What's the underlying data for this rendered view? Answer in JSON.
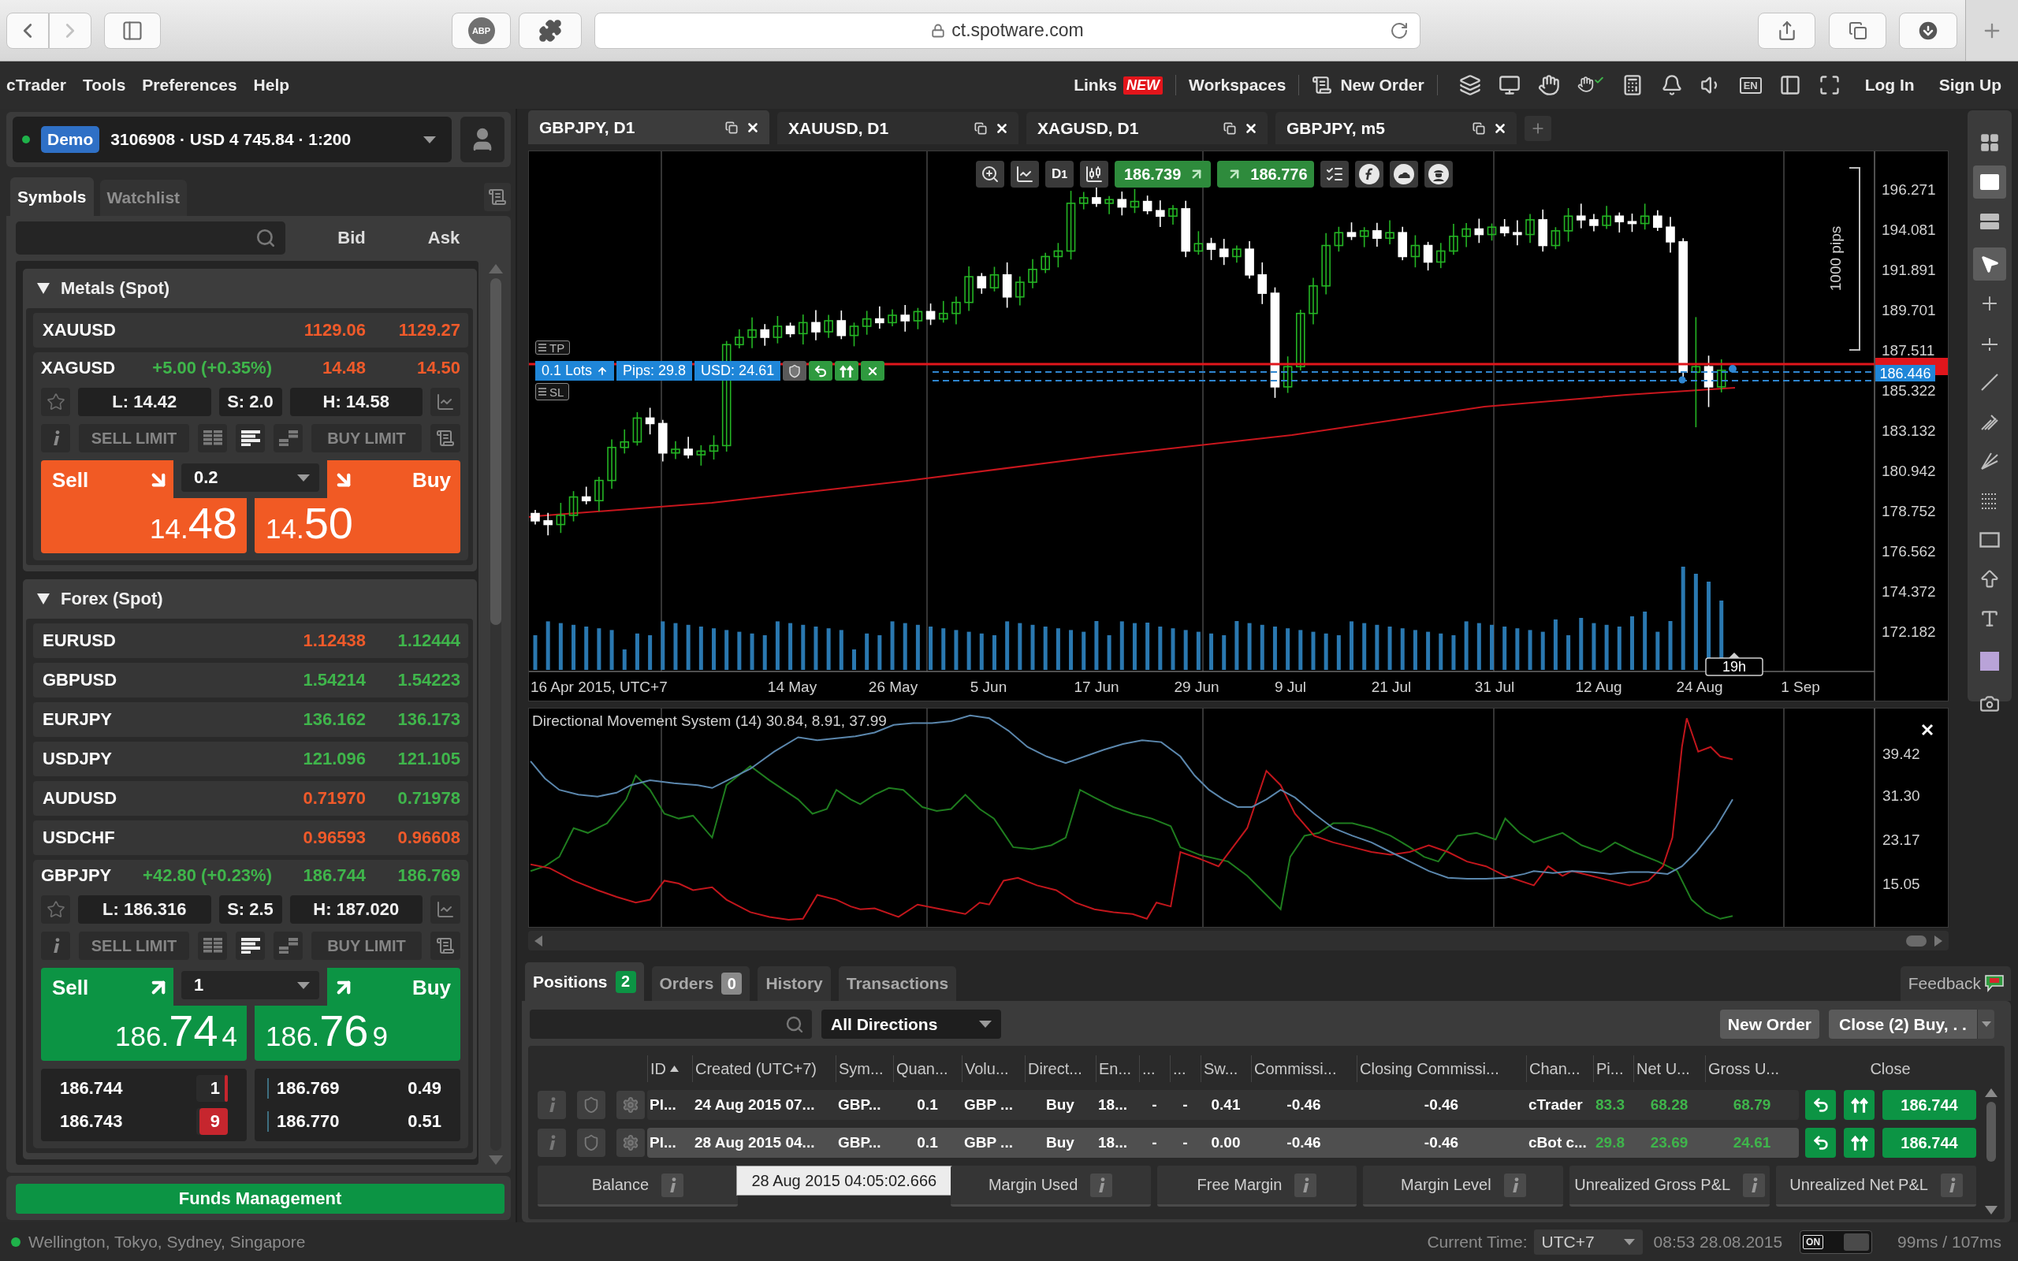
{
  "browser": {
    "extension_badge": "ABP",
    "url": "ct.spotware.com"
  },
  "menu": {
    "items": [
      "cTrader",
      "Tools",
      "Preferences",
      "Help"
    ],
    "links": "Links",
    "links_badge": "NEW",
    "workspaces": "Workspaces",
    "new_order": "New Order",
    "language": "EN",
    "log_in": "Log In",
    "sign_up": "Sign Up"
  },
  "account": {
    "connected": true,
    "mode": "Demo",
    "summary": "3106908 · USD 4 745.84 · 1:200"
  },
  "symbol_tabs": [
    {
      "label": "Symbols",
      "selected": true
    },
    {
      "label": "Watchlist",
      "selected": false
    }
  ],
  "quote_headers": [
    "Bid",
    "Ask"
  ],
  "groups": [
    {
      "name": "Metals (Spot)",
      "expanded": true,
      "symbols": [
        {
          "kind": "row",
          "name": "XAUUSD",
          "bid": "1129.06",
          "ask": "1129.27",
          "bid_up": false,
          "ask_up": false
        },
        {
          "kind": "card",
          "name": "XAGUSD",
          "change": "+5.00 (+0.35%)",
          "change_up": true,
          "bid": "14.48",
          "ask": "14.50",
          "bid_up": false,
          "ask_up": false,
          "favorite": false,
          "low": "L: 14.42",
          "spread": "S: 2.0",
          "high": "H: 14.58",
          "sell_limit": "SELL LIMIT",
          "buy_limit": "BUY LIMIT",
          "views": [
            {
              "kind": "columns",
              "selected": false
            },
            {
              "kind": "ladder",
              "selected": true
            },
            {
              "kind": "depth",
              "selected": false
            }
          ],
          "rising": false,
          "quantity": "0.2",
          "sell": {
            "label": "Sell",
            "head": "14.",
            "big": "48"
          },
          "buy": {
            "label": "Buy",
            "head": "14.",
            "big": "50"
          }
        }
      ]
    },
    {
      "name": "Forex (Spot)",
      "expanded": true,
      "symbols": [
        {
          "kind": "row",
          "name": "EURUSD",
          "bid": "1.12438",
          "ask": "1.12444",
          "bid_up": false,
          "ask_up": true
        },
        {
          "kind": "row",
          "name": "GBPUSD",
          "bid": "1.54214",
          "ask": "1.54223",
          "bid_up": true,
          "ask_up": true
        },
        {
          "kind": "row",
          "name": "EURJPY",
          "bid": "136.162",
          "ask": "136.173",
          "bid_up": true,
          "ask_up": true
        },
        {
          "kind": "row",
          "name": "USDJPY",
          "bid": "121.096",
          "ask": "121.105",
          "bid_up": true,
          "ask_up": true
        },
        {
          "kind": "row",
          "name": "AUDUSD",
          "bid": "0.71970",
          "ask": "0.71978",
          "bid_up": false,
          "ask_up": true
        },
        {
          "kind": "row",
          "name": "USDCHF",
          "bid": "0.96593",
          "ask": "0.96608",
          "bid_up": false,
          "ask_up": false
        },
        {
          "kind": "card",
          "name": "GBPJPY",
          "change": "+42.80 (+0.23%)",
          "change_up": true,
          "bid": "186.744",
          "ask": "186.769",
          "bid_up": true,
          "ask_up": true,
          "favorite": false,
          "low": "L: 186.316",
          "spread": "S: 2.5",
          "high": "H: 187.020",
          "sell_limit": "SELL LIMIT",
          "buy_limit": "BUY LIMIT",
          "views": [
            {
              "kind": "columns",
              "selected": false
            },
            {
              "kind": "ladder",
              "selected": true
            },
            {
              "kind": "depth",
              "selected": false
            }
          ],
          "rising": true,
          "quantity": "1",
          "sell": {
            "label": "Sell",
            "head": "186.",
            "big": "74",
            "tail": "4"
          },
          "buy": {
            "label": "Buy",
            "head": "186.",
            "big": "76",
            "tail": "9"
          },
          "depth": {
            "bids": [
              {
                "price": "186.744",
                "size": "1",
                "level": 0.1
              },
              {
                "price": "186.743",
                "size": "9",
                "level": 0.9
              }
            ],
            "asks": [
              {
                "price": "186.769",
                "size": "0.49"
              },
              {
                "price": "186.770",
                "size": "0.51"
              }
            ]
          }
        }
      ]
    }
  ],
  "funds_button": "Funds Management",
  "chart_tabs": [
    {
      "label": "GBPJPY, D1",
      "selected": true
    },
    {
      "label": "XAUUSD, D1",
      "selected": false
    },
    {
      "label": "XAGUSD, D1",
      "selected": false
    },
    {
      "label": "GBPJPY, m5",
      "selected": false
    }
  ],
  "chart": {
    "period": "D",
    "period_count": "1",
    "sell_price": "186.739",
    "buy_price": "186.776",
    "price_axis": [
      "196.271",
      "194.081",
      "191.891",
      "189.701",
      "187.511",
      "185.322",
      "183.132",
      "180.942",
      "178.752",
      "176.562",
      "174.372",
      "172.182"
    ],
    "price_tag": "186.446",
    "date_axis": [
      "16 Apr 2015, UTC+7",
      "14 May",
      "26 May",
      "5 Jun",
      "17 Jun",
      "29 Jun",
      "9 Jul",
      "21 Jul",
      "31 Jul",
      "12 Aug",
      "24 Aug",
      "1 Sep"
    ],
    "time_marker": "19h",
    "range_label": "1000 pips",
    "take_profit": "TP",
    "stop_loss": "SL",
    "position": {
      "lots": "0.1 Lots",
      "pips": "Pips: 29.8",
      "usd": "USD: 24.61"
    }
  },
  "indicator": {
    "title": "Directional Movement System (14) 30.84, 8.91, 37.99",
    "axis": [
      "39.42",
      "31.30",
      "23.17",
      "15.05"
    ]
  },
  "tool_groups": [
    {
      "tools": [
        {
          "kind": "grid",
          "selected": false
        },
        {
          "kind": "single",
          "selected": true
        },
        {
          "kind": "rows",
          "selected": false
        }
      ]
    },
    {
      "tools": [
        {
          "kind": "cursor",
          "selected": true
        },
        {
          "kind": "crosshair",
          "selected": false
        },
        {
          "kind": "ray",
          "selected": false
        },
        {
          "kind": "line",
          "selected": false
        },
        {
          "kind": "pitchfork",
          "selected": false
        },
        {
          "kind": "fan",
          "selected": false
        },
        {
          "kind": "fibonacci",
          "selected": false
        },
        {
          "kind": "rectangle",
          "selected": false
        },
        {
          "kind": "arrow",
          "selected": false
        },
        {
          "kind": "text",
          "selected": false
        }
      ]
    },
    {
      "tools": [
        {
          "kind": "color",
          "selected": false,
          "color": "#b9a3d8"
        }
      ]
    },
    {
      "tools": [
        {
          "kind": "camera",
          "selected": false
        }
      ]
    }
  ],
  "bottom_tabs": [
    {
      "label": "Positions",
      "count": "2",
      "selected": true
    },
    {
      "label": "Orders",
      "count": "0",
      "selected": false
    },
    {
      "label": "History",
      "selected": false
    },
    {
      "label": "Transactions",
      "selected": false
    }
  ],
  "feedback": "Feedback",
  "filters": {
    "direction": "All Directions",
    "new_order": "New Order",
    "close": "Close (2) Buy, . ."
  },
  "positions": {
    "columns": [
      {
        "label": "ID",
        "sorted": true,
        "kind": "text"
      },
      {
        "label": "Created (UTC+7)",
        "sorted": false,
        "kind": "text"
      },
      {
        "label": "Sym...",
        "sorted": false,
        "kind": "text"
      },
      {
        "label": "Quan...",
        "sorted": false,
        "kind": "text"
      },
      {
        "label": "Volu...",
        "sorted": false,
        "kind": "text"
      },
      {
        "label": "Direct...",
        "sorted": false,
        "kind": "text"
      },
      {
        "label": "En...",
        "sorted": false,
        "kind": "text"
      },
      {
        "label": "...",
        "sorted": false,
        "kind": "text"
      },
      {
        "label": "...",
        "sorted": false,
        "kind": "text"
      },
      {
        "label": "Sw...",
        "sorted": false,
        "kind": "text"
      },
      {
        "label": "Commissi...",
        "sorted": false,
        "kind": "text"
      },
      {
        "label": "Closing Commissi...",
        "sorted": false,
        "kind": "text"
      },
      {
        "label": "Chan...",
        "sorted": false,
        "kind": "text"
      },
      {
        "label": "Pi...",
        "sorted": false,
        "kind": "pnl"
      },
      {
        "label": "Net U...",
        "sorted": false,
        "kind": "pnl"
      },
      {
        "label": "Gross U...",
        "sorted": false,
        "kind": "pnl"
      }
    ],
    "close_header": "Close",
    "rows": [
      {
        "selected": false,
        "profit": true,
        "cells": [
          "Pl...",
          "24 Aug 2015 07...",
          "GBP...",
          "0.1",
          "GBP ...",
          "Buy",
          "18...",
          "-",
          "-",
          "0.41",
          "-0.46",
          "-0.46",
          "cTrader",
          "83.3",
          "68.28",
          "68.79"
        ],
        "close_price": "186.744"
      },
      {
        "selected": true,
        "profit": true,
        "cells": [
          "Pl...",
          "28 Aug 2015 04...",
          "GBP...",
          "0.1",
          "GBP ...",
          "Buy",
          "18...",
          "-",
          "-",
          "0.00",
          "-0.46",
          "-0.46",
          "cBot c...",
          "29.8",
          "23.69",
          "24.61"
        ],
        "close_price": "186.744"
      }
    ]
  },
  "summary": {
    "cells": [
      "Balance",
      "Margin Used",
      "Free Margin",
      "Margin Level",
      "Unrealized Gross P&L",
      "Unrealized Net P&L"
    ],
    "tooltip": "28 Aug 2015 04:05:02.666"
  },
  "status": {
    "market_open": true,
    "sessions": "Wellington, Tokyo, Sydney, Singapore",
    "time_label": "Current Time:",
    "timezone": "UTC+7",
    "clock": "08:53 28.08.2015",
    "toggle_label": "ON",
    "toggle_on": true,
    "latency": "99ms / 107ms"
  }
}
